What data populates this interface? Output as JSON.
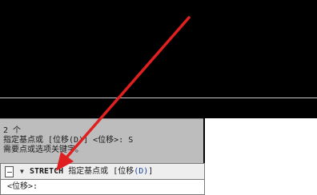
{
  "history": {
    "line1": "2 个",
    "line2": "指定基点或 [位移(D)] <位移>: S",
    "line3": "需要点或选项关键字。"
  },
  "command_bar": {
    "command_name": "STRETCH",
    "prompt": "指定基点或 [位移",
    "option": "(D)",
    "prompt_end": "]",
    "input_prompt": "<位移>:"
  },
  "colors": {
    "canvas_bg": "#000000",
    "annotation_arrow": "#e02020",
    "history_bg": "#bdbdbd"
  },
  "icons": [
    "command-line-icon",
    "dropdown-arrow-icon"
  ]
}
